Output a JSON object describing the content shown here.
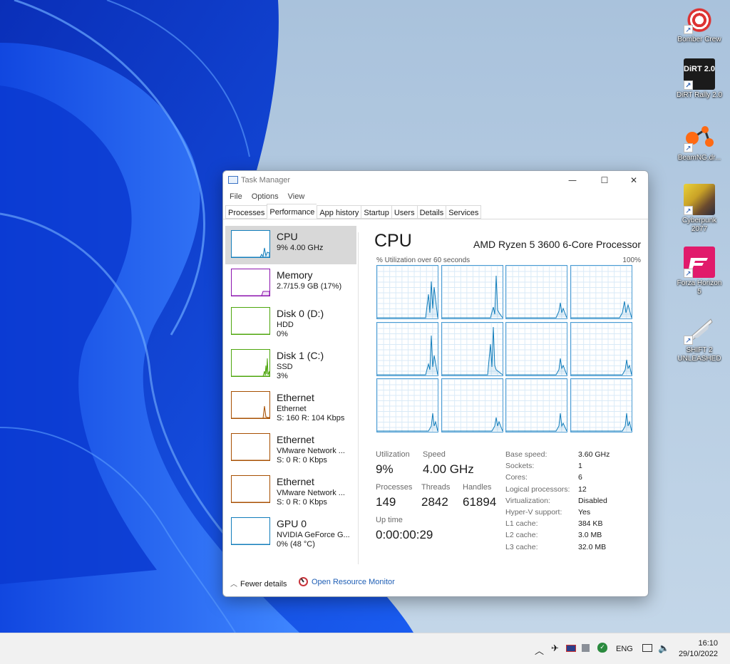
{
  "desktop": {
    "icons": [
      {
        "label": "Bomber Crew",
        "icon": "bomber-crew-icon"
      },
      {
        "label": "DiRT Rally 2.0",
        "icon": "dirt-rally-icon",
        "logo_text": "DiRT 2.0"
      },
      {
        "label": "BeamNG.dr...",
        "icon": "beamng-icon"
      },
      {
        "label": "Cyberpunk 2077",
        "icon": "cyberpunk-icon"
      },
      {
        "label": "Forza Horizon 5",
        "icon": "forza-icon"
      },
      {
        "label": "SHIFT 2 UNLEASHED",
        "icon": "shift2-icon"
      }
    ]
  },
  "window": {
    "title": "Task Manager",
    "controls": {
      "minimize": "—",
      "maximize": "☐",
      "close": "✕"
    },
    "menu": [
      "File",
      "Options",
      "View"
    ],
    "tabs": [
      "Processes",
      "Performance",
      "App history",
      "Startup",
      "Users",
      "Details",
      "Services"
    ],
    "active_tab": "Performance"
  },
  "sidebar": [
    {
      "title": "CPU",
      "line1": "9%  4.00 GHz",
      "line2": "",
      "color": "#117dbb",
      "selected": true
    },
    {
      "title": "Memory",
      "line1": "2.7/15.9 GB (17%)",
      "line2": "",
      "color": "#8b12ae"
    },
    {
      "title": "Disk 0 (D:)",
      "line1": "HDD",
      "line2": "0%",
      "color": "#4da60c"
    },
    {
      "title": "Disk 1 (C:)",
      "line1": "SSD",
      "line2": "3%",
      "color": "#4da60c"
    },
    {
      "title": "Ethernet",
      "line1": "Ethernet",
      "line2": "S: 160  R: 104 Kbps",
      "color": "#a74f01"
    },
    {
      "title": "Ethernet",
      "line1": "VMware Network ...",
      "line2": "S: 0  R: 0 Kbps",
      "color": "#a74f01"
    },
    {
      "title": "Ethernet",
      "line1": "VMware Network ...",
      "line2": "S: 0  R: 0 Kbps",
      "color": "#a74f01"
    },
    {
      "title": "GPU 0",
      "line1": "NVIDIA GeForce G...",
      "line2": "0%  (48 °C)",
      "color": "#117dbb"
    }
  ],
  "cpu": {
    "heading": "CPU",
    "model": "AMD Ryzen 5 3600 6-Core Processor",
    "graph_caption": "% Utilization over 60 seconds",
    "graph_max": "100%",
    "accent": "#117dbb",
    "stats": {
      "utilization_label": "Utilization",
      "utilization": "9%",
      "speed_label": "Speed",
      "speed": "4.00 GHz",
      "processes_label": "Processes",
      "processes": "149",
      "threads_label": "Threads",
      "threads": "2842",
      "handles_label": "Handles",
      "handles": "61894",
      "uptime_label": "Up time",
      "uptime": "0:00:00:29"
    },
    "specs": [
      {
        "label": "Base speed:",
        "value": "3.60 GHz"
      },
      {
        "label": "Sockets:",
        "value": "1"
      },
      {
        "label": "Cores:",
        "value": "6"
      },
      {
        "label": "Logical processors:",
        "value": "12"
      },
      {
        "label": "Virtualization:",
        "value": "Disabled"
      },
      {
        "label": "Hyper-V support:",
        "value": "Yes"
      },
      {
        "label": "L1 cache:",
        "value": "384 KB"
      },
      {
        "label": "L2 cache:",
        "value": "3.0 MB"
      },
      {
        "label": "L3 cache:",
        "value": "32.0 MB"
      }
    ]
  },
  "footer": {
    "fewer_details": "Fewer details",
    "resource_monitor": "Open Resource Monitor"
  },
  "taskbar": {
    "language": "ENG",
    "time": "16:10",
    "date": "29/10/2022"
  }
}
